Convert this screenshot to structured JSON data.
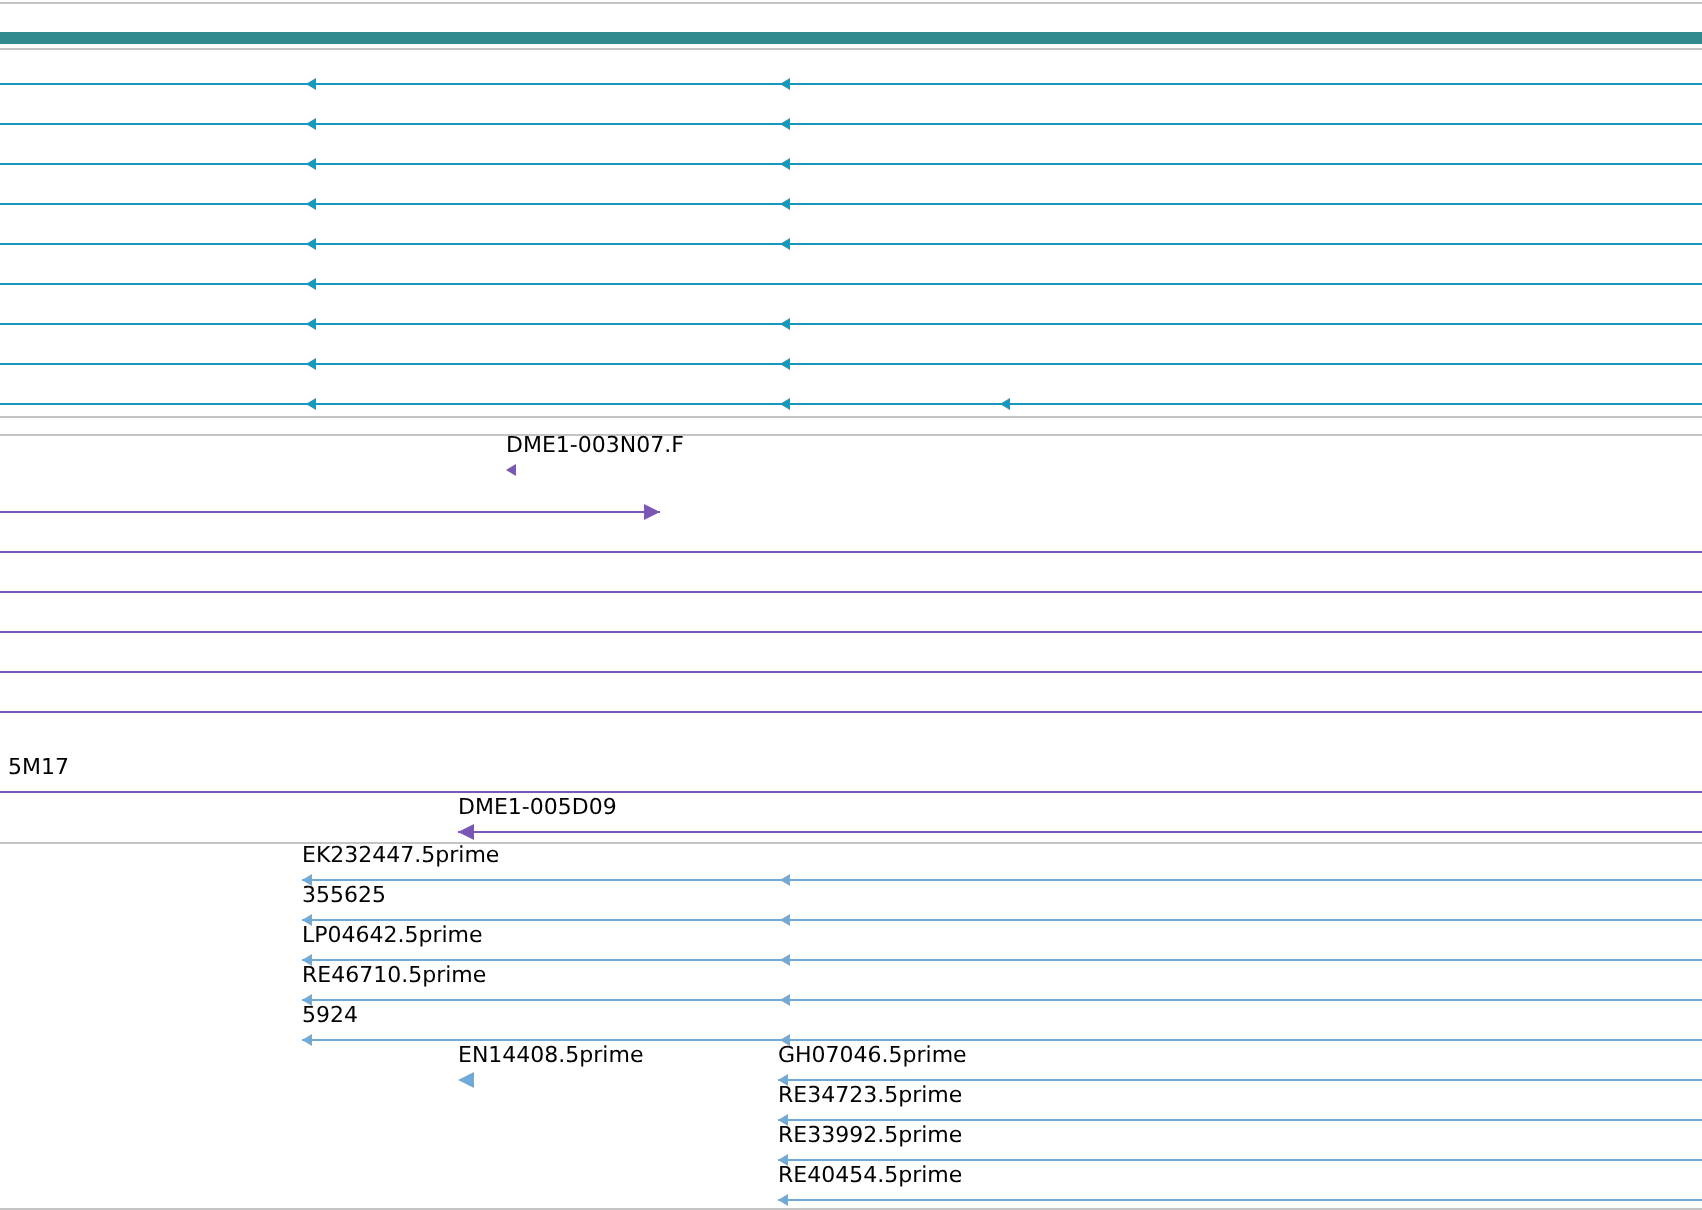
{
  "tracks": [
    {
      "color": "#1799bd",
      "features": [
        {
          "kind": "arrow",
          "reverse": true
        },
        {
          "kind": "arrow",
          "reverse": true
        },
        {
          "kind": "arrow",
          "reverse": true
        },
        {
          "kind": "arrow",
          "reverse": true
        },
        {
          "kind": "arrow",
          "reverse": true
        },
        {
          "kind": "arrow",
          "reverse": true
        },
        {
          "kind": "arrow",
          "reverse": true
        },
        {
          "kind": "arrow",
          "reverse": true
        },
        {
          "kind": "arrow",
          "reverse": true
        }
      ]
    },
    {
      "color": "#7a57b5",
      "features": [
        {
          "kind": "arrow",
          "label": "DME1-003N07.F",
          "reverse": true
        },
        {
          "kind": "arrow",
          "reverse": false
        },
        {
          "kind": "line"
        },
        {
          "kind": "line"
        },
        {
          "kind": "line"
        },
        {
          "kind": "line"
        },
        {
          "kind": "line"
        },
        {
          "kind": "line",
          "label": "5M17"
        },
        {
          "kind": "arrow",
          "label": "DME1-005D09",
          "reverse": true
        }
      ]
    },
    {
      "color": "#6faad8",
      "features": [
        {
          "kind": "arrow",
          "label": "EK232447.5prime",
          "reverse": true
        },
        {
          "kind": "arrow",
          "label": "355625",
          "reverse": true
        },
        {
          "kind": "arrow",
          "label": "LP04642.5prime",
          "reverse": true
        },
        {
          "kind": "arrow",
          "label": "RE46710.5prime",
          "reverse": true
        },
        {
          "kind": "arrow",
          "label": "5924",
          "reverse": true
        },
        {
          "kind": "arrow",
          "label": "EN14408.5prime",
          "reverse": true
        },
        {
          "kind": "arrow",
          "label": "GH07046.5prime",
          "reverse": true
        },
        {
          "kind": "arrow",
          "label": "RE34723.5prime",
          "reverse": true
        },
        {
          "kind": "arrow",
          "label": "RE33992.5prime",
          "reverse": true
        },
        {
          "kind": "arrow",
          "label": "RE40454.5prime",
          "reverse": true
        }
      ]
    }
  ]
}
